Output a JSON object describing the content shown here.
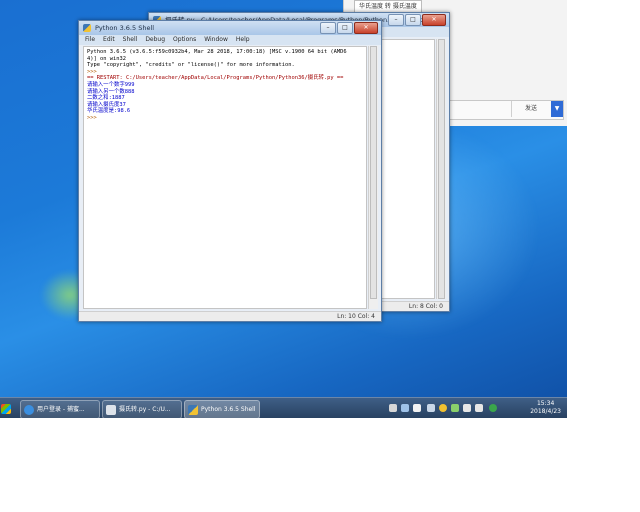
{
  "colors": {
    "accent": "#1c7ad8",
    "taskbar": "#2f4b70",
    "stdout_blue": "#0000cc",
    "prompt_orange": "#b15a00"
  },
  "bgapp": {
    "top_button": "华氏温度 转 摄氏温度",
    "send_label": "发送",
    "dropdown_icon": "chevron-down-icon"
  },
  "editor": {
    "title": "摄氏转.py - C:/Users/teacher/AppData/Local/Programs/Python/Python36/摄氏转.py",
    "status": "Ln: 8   Col: 0"
  },
  "shell": {
    "title": "Python 3.6.5 Shell",
    "menu": [
      "File",
      "Edit",
      "Shell",
      "Debug",
      "Options",
      "Window",
      "Help"
    ],
    "lines": [
      {
        "text": "Python 3.6.5 (v3.6.5:f59c0932b4, Mar 28 2018, 17:00:18) [MSC v.1900 64 bit (AMD6",
        "style": ""
      },
      {
        "text": "4)] on win32",
        "style": ""
      },
      {
        "text": "Type \"copyright\", \"credits\" or \"license()\" for more information.",
        "style": ""
      },
      {
        "text": ">>> ",
        "style": "prompt"
      },
      {
        "text": "== RESTART: C:/Users/teacher/AppData/Local/Programs/Python/Python36/摄氏转.py ==",
        "style": "red"
      },
      {
        "text": "请输入一个数字999",
        "style": "stdout"
      },
      {
        "text": "请输入另一个数888",
        "style": "stdout"
      },
      {
        "text": "二数之和:1887",
        "style": "stdout"
      },
      {
        "text": "请输入摄氏度37",
        "style": "stdout"
      },
      {
        "text": "华氏温度是:98.6",
        "style": "stdout"
      },
      {
        "text": ">>> ",
        "style": "prompt"
      }
    ],
    "status": "Ln: 10   Col: 4"
  },
  "taskbar": {
    "items": [
      {
        "label": "用户登录 - 捕蜜...",
        "icon": "ie-icon"
      },
      {
        "label": "摄氏转.py - C:/U...",
        "icon": "python-file-icon"
      },
      {
        "label": "Python 3.6.5 Shell",
        "icon": "python-shell-icon"
      }
    ],
    "time": "15:34",
    "date": "2018/4/23"
  }
}
